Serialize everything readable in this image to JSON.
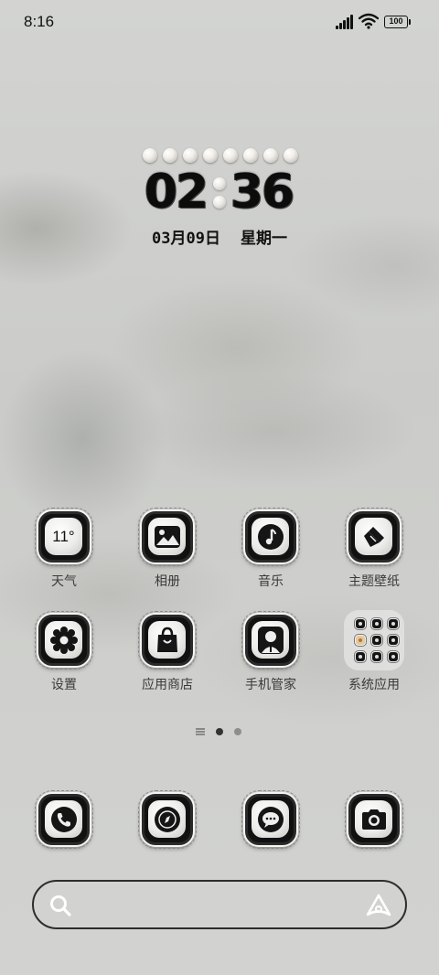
{
  "status_bar": {
    "time": "8:16",
    "battery": "100",
    "icons": [
      "signal-icon",
      "wifi-icon",
      "battery-icon"
    ]
  },
  "clock_widget": {
    "hours": "02",
    "minutes": "36",
    "date": "03月09日",
    "weekday": "星期一"
  },
  "apps": [
    {
      "label": "天气",
      "icon": "weather-icon",
      "badge": "11°"
    },
    {
      "label": "相册",
      "icon": "gallery-icon"
    },
    {
      "label": "音乐",
      "icon": "music-icon"
    },
    {
      "label": "主题壁纸",
      "icon": "theme-brush-icon"
    },
    {
      "label": "设置",
      "icon": "settings-gear-icon"
    },
    {
      "label": "应用商店",
      "icon": "app-store-bag-icon"
    },
    {
      "label": "手机管家",
      "icon": "phone-manager-icon"
    },
    {
      "label": "系统应用",
      "icon": "folder-icon"
    }
  ],
  "page_indicator": {
    "pages": 2,
    "current": 1
  },
  "dock": [
    {
      "icon": "phone-icon"
    },
    {
      "icon": "browser-compass-icon"
    },
    {
      "icon": "messages-icon"
    },
    {
      "icon": "camera-icon"
    }
  ],
  "search_bar": {
    "left_icon": "search-icon",
    "right_icon": "assistant-icon"
  },
  "colors": {
    "icon_body": "#111111",
    "wallpaper": "#cfd0ce",
    "label": "#3a3a3a"
  }
}
